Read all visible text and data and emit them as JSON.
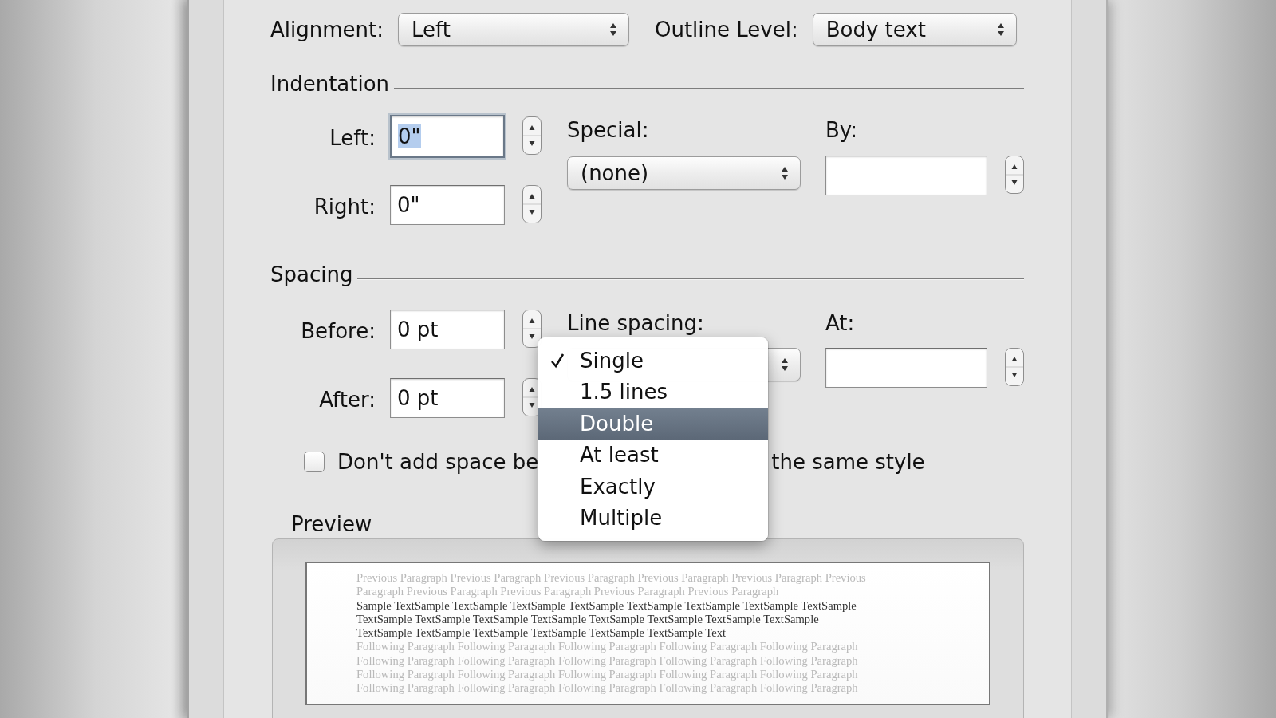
{
  "alignment": {
    "label": "Alignment:",
    "value": "Left"
  },
  "outline_level": {
    "label": "Outline Level:",
    "value": "Body text"
  },
  "indentation": {
    "title": "Indentation",
    "left": {
      "label": "Left:",
      "value": "0\"",
      "focused": true
    },
    "right": {
      "label": "Right:",
      "value": "0\"",
      "focused": false
    },
    "special": {
      "label": "Special:",
      "value": "(none)"
    },
    "by": {
      "label": "By:"
    }
  },
  "spacing": {
    "title": "Spacing",
    "before": {
      "label": "Before:",
      "value": "0 pt",
      "focused": false
    },
    "after": {
      "label": "After:",
      "value": "0 pt",
      "focused": false
    },
    "line_spacing": {
      "label": "Line spacing:"
    },
    "at": {
      "label": "At:"
    }
  },
  "checkbox": {
    "label_start": "Don't add space be",
    "label_end": "the same style",
    "checked": false
  },
  "line_spacing_menu": {
    "items": [
      {
        "label": "Single",
        "checked": true,
        "selected": false
      },
      {
        "label": "1.5 lines",
        "checked": false,
        "selected": false
      },
      {
        "label": "Double",
        "checked": false,
        "selected": true
      },
      {
        "label": "At least",
        "checked": false,
        "selected": false
      },
      {
        "label": "Exactly",
        "checked": false,
        "selected": false
      },
      {
        "label": "Multiple",
        "checked": false,
        "selected": false
      }
    ]
  },
  "preview": {
    "title": "Preview",
    "previous_lines": [
      "Previous Paragraph Previous Paragraph Previous Paragraph Previous Paragraph Previous Paragraph Previous",
      "Paragraph Previous Paragraph Previous Paragraph Previous Paragraph Previous Paragraph"
    ],
    "sample_lines": [
      "Sample TextSample TextSample TextSample TextSample TextSample TextSample TextSample TextSample",
      "TextSample TextSample TextSample TextSample TextSample TextSample TextSample TextSample",
      "TextSample TextSample TextSample TextSample TextSample TextSample Text"
    ],
    "following_lines": [
      "Following Paragraph Following Paragraph Following Paragraph Following Paragraph Following Paragraph",
      "Following Paragraph Following Paragraph Following Paragraph Following Paragraph Following Paragraph",
      "Following Paragraph Following Paragraph Following Paragraph Following Paragraph Following Paragraph",
      "Following Paragraph Following Paragraph Following Paragraph Following Paragraph Following Paragraph"
    ]
  }
}
